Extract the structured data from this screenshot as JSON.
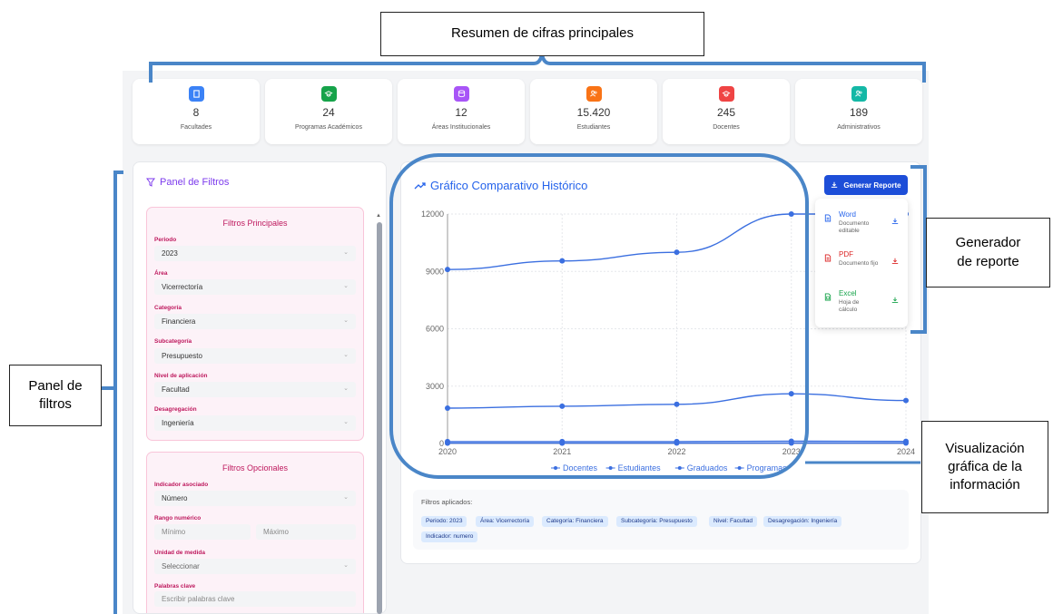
{
  "stats": [
    {
      "value": "8",
      "label": "Facultades",
      "color": "#3b82f6",
      "icon": "building-icon"
    },
    {
      "value": "24",
      "label": "Programas Académicos",
      "color": "#16a34a",
      "icon": "graduation-cap-icon"
    },
    {
      "value": "12",
      "label": "Áreas Institucionales",
      "color": "#a855f7",
      "icon": "database-icon"
    },
    {
      "value": "15.420",
      "label": "Estudiantes",
      "color": "#f97316",
      "icon": "users-icon"
    },
    {
      "value": "245",
      "label": "Docentes",
      "color": "#ef4444",
      "icon": "graduation-cap-icon"
    },
    {
      "value": "189",
      "label": "Administrativos",
      "color": "#14b8a6",
      "icon": "users-icon"
    }
  ],
  "annotations": {
    "summary": "Resumen de cifras principales",
    "filters_line1": "Panel de",
    "filters_line2": "filtros",
    "report_line1": "Generador",
    "report_line2": "de reporte",
    "viz_line1": "Visualización",
    "viz_line2": "gráfica de la",
    "viz_line3": "información"
  },
  "filters": {
    "title": "Panel de Filtros",
    "main_title": "Filtros Principales",
    "periodo_label": "Periodo",
    "periodo_value": "2023",
    "area_label": "Área",
    "area_value": "Vicerrectoría",
    "categoria_label": "Categoría",
    "categoria_value": "Financiera",
    "subcategoria_label": "Subcategoría",
    "subcategoria_value": "Presupuesto",
    "nivel_label": "Nivel de aplicación",
    "nivel_value": "Facultad",
    "desagregacion_label": "Desagregación",
    "desagregacion_value": "Ingeniería",
    "optional_title": "Filtros Opcionales",
    "indicador_label": "Indicador asociado",
    "indicador_value": "Número",
    "rango_label": "Rango numérico",
    "rango_min_placeholder": "Mínimo",
    "rango_max_placeholder": "Máximo",
    "unidad_label": "Unidad de medida",
    "unidad_value": "Seleccionar",
    "palabras_label": "Palabras clave",
    "palabras_placeholder": "Escribir palabras clave"
  },
  "chart_panel": {
    "title": "Gráfico Comparativo Histórico",
    "generate_label": "Generar Reporte",
    "menu": [
      {
        "name": "Word",
        "desc": "Documento editable",
        "color": "#2563eb",
        "icon": "file-icon"
      },
      {
        "name": "PDF",
        "desc": "Documento fijo",
        "color": "#dc2626",
        "icon": "file-icon"
      },
      {
        "name": "Excel",
        "desc": "Hoja de cálculo",
        "color": "#16a34a",
        "icon": "spreadsheet-icon"
      }
    ],
    "applied_label": "Filtros aplicados:",
    "tags": [
      "Periodo: 2023",
      "Área: Vicerrectoría",
      "Categoría: Financiera",
      "Subcategoría: Presupuesto",
      "Nivel: Facultad",
      "Desagregación: Ingeniería",
      "Indicador: numero"
    ]
  },
  "chart_data": {
    "type": "line",
    "categories": [
      "2020",
      "2021",
      "2022",
      "2023",
      "2024"
    ],
    "ylim": [
      0,
      12000
    ],
    "yticks": [
      "0",
      "3000",
      "6000",
      "9000",
      "12000"
    ],
    "series": [
      {
        "name": "Docentes",
        "values": [
          9100,
          9550,
          10000,
          12000,
          12000
        ]
      },
      {
        "name": "Estudiantes",
        "values": [
          1850,
          1950,
          2050,
          2600,
          2250
        ]
      },
      {
        "name": "Graduados",
        "values": [
          100,
          100,
          100,
          120,
          110
        ]
      },
      {
        "name": "Programas",
        "values": [
          20,
          20,
          22,
          24,
          24
        ]
      }
    ],
    "color": "#3b6fe0"
  }
}
